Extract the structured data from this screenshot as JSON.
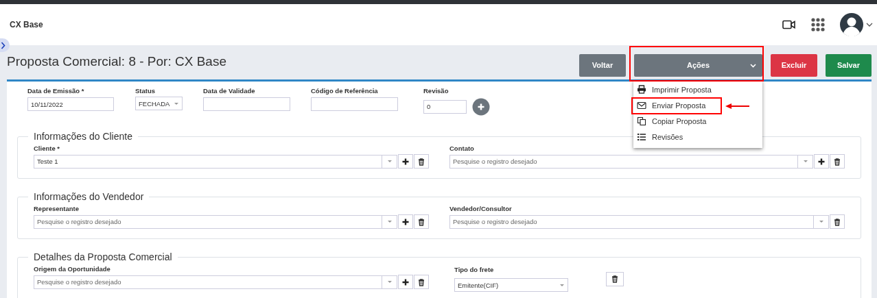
{
  "app": {
    "brand": "CX Base"
  },
  "page": {
    "title": "Proposta Comercial: 8 - Por: CX Base"
  },
  "toolbar": {
    "buttons": [
      {
        "label": "Voltar",
        "kind": "secondary"
      },
      {
        "label": "Ações",
        "kind": "menu",
        "highlighted": true
      },
      {
        "label": "Excluir",
        "kind": "danger"
      },
      {
        "label": "Salvar",
        "kind": "success"
      }
    ]
  },
  "actions_menu": {
    "items": [
      {
        "label": "Imprimir Proposta",
        "highlighted": false
      },
      {
        "label": "Enviar Proposta",
        "highlighted": true
      },
      {
        "label": "Copiar Proposta",
        "highlighted": false
      },
      {
        "label": "Revisões",
        "highlighted": false
      }
    ]
  },
  "header_fields": [
    {
      "label": "Data de Emissão *",
      "kind": "text",
      "value": "10/11/2022"
    },
    {
      "label": "Status",
      "kind": "select",
      "value": "FECHADA"
    },
    {
      "label": "Data de Validade",
      "kind": "text"
    },
    {
      "label": "Código de Referência",
      "kind": "text"
    },
    {
      "label": "Revisão",
      "kind": "revision",
      "value": "0"
    }
  ],
  "sections": [
    {
      "title": "Informações do Cliente",
      "fields": [
        {
          "label": "Cliente *",
          "kind": "lookup",
          "value": "Teste 1",
          "add_button": true
        },
        {
          "label": "Contato",
          "kind": "lookup",
          "placeholder": "Pesquise o registro desejado",
          "add_button": true
        }
      ]
    },
    {
      "title": "Informações do Vendedor",
      "fields": [
        {
          "label": "Representante",
          "kind": "lookup",
          "placeholder": "Pesquise o registro desejado",
          "add_button": true
        },
        {
          "label": "Vendedor/Consultor",
          "kind": "lookup",
          "placeholder": "Pesquise o registro desejado",
          "add_button": false
        }
      ]
    },
    {
      "title": "Detalhes da Proposta Comercial",
      "fields": [
        {
          "label": "Origem da Oportunidade",
          "kind": "lookup",
          "placeholder": "Pesquise o registro desejado",
          "add_button": true
        },
        {
          "label": "Tipo do frete",
          "kind": "select_delete",
          "value": "Emitente(CIF)"
        }
      ]
    }
  ]
}
